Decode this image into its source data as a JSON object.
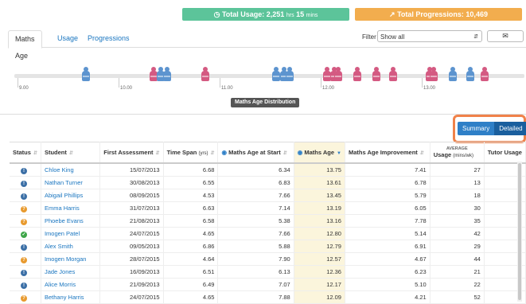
{
  "stats": {
    "usage_label": "Total Usage: 2,251",
    "usage_hrs_unit": "hrs",
    "usage_mins": "15",
    "usage_mins_unit": "mins",
    "progressions_label": "Total Progressions: 10,469",
    "usage_icon": "clock-icon",
    "progressions_icon": "chart-icon",
    "usage_color": "#5cc49a",
    "progressions_color": "#f2ad4e"
  },
  "tabs": [
    {
      "label": "Maths Age",
      "active": true
    },
    {
      "label": "Usage",
      "active": false
    },
    {
      "label": "Progressions",
      "active": false
    }
  ],
  "filter": {
    "label": "Filter",
    "value": "Show all"
  },
  "email_icon": "envelope-icon",
  "distribution": {
    "title": "Maths Age Distribution",
    "ticks": [
      "9.00",
      "10.00",
      "11.00",
      "12.00",
      "13.00"
    ],
    "pins": [
      {
        "value": 9.68,
        "color": "blue"
      },
      {
        "value": 10.35,
        "color": "pink"
      },
      {
        "value": 10.42,
        "color": "blue"
      },
      {
        "value": 10.48,
        "color": "blue"
      },
      {
        "value": 10.86,
        "color": "pink"
      },
      {
        "value": 11.56,
        "color": "blue"
      },
      {
        "value": 11.64,
        "color": "blue"
      },
      {
        "value": 11.69,
        "color": "blue"
      },
      {
        "value": 12.06,
        "color": "pink"
      },
      {
        "value": 12.13,
        "color": "pink"
      },
      {
        "value": 12.17,
        "color": "pink"
      },
      {
        "value": 12.36,
        "color": "pink"
      },
      {
        "value": 12.55,
        "color": "pink"
      },
      {
        "value": 12.72,
        "color": "pink"
      },
      {
        "value": 13.08,
        "color": "pink"
      },
      {
        "value": 13.12,
        "color": "pink"
      },
      {
        "value": 13.31,
        "color": "blue"
      },
      {
        "value": 13.48,
        "color": "blue"
      },
      {
        "value": 13.62,
        "color": "pink"
      }
    ]
  },
  "view_toggle": {
    "summary": "Summary",
    "detailed": "Detailed"
  },
  "table": {
    "headers": {
      "status": "Status",
      "student": "Student",
      "first_assessment": "First Assessment",
      "time_span": "Time Span",
      "time_span_unit": "(yrs)",
      "age_start": "Maths Age at Start",
      "maths_age": "Maths Age",
      "improvement": "Maths Age Improvement",
      "usage_top": "AVERAGE",
      "usage": "Usage",
      "usage_unit": "(mins/wk)",
      "tutor": "Tutor Usage"
    },
    "rows": [
      {
        "status": "info",
        "student": "Chloe King",
        "first": "15/07/2013",
        "span": "6.68",
        "start": "6.34",
        "age": "13.75",
        "improvement": "7.41",
        "usage": "27"
      },
      {
        "status": "info",
        "student": "Nathan Turner",
        "first": "30/08/2013",
        "span": "6.55",
        "start": "6.83",
        "age": "13.61",
        "improvement": "6.78",
        "usage": "13"
      },
      {
        "status": "info",
        "student": "Abigail Phillips",
        "first": "08/09/2015",
        "span": "4.53",
        "start": "7.66",
        "age": "13.45",
        "improvement": "5.79",
        "usage": "18"
      },
      {
        "status": "warn",
        "student": "Emma Harris",
        "first": "31/07/2013",
        "span": "6.63",
        "start": "7.14",
        "age": "13.19",
        "improvement": "6.05",
        "usage": "30"
      },
      {
        "status": "warn",
        "student": "Phoebe Evans",
        "first": "21/08/2013",
        "span": "6.58",
        "start": "5.38",
        "age": "13.16",
        "improvement": "7.78",
        "usage": "35"
      },
      {
        "status": "ok",
        "student": "Imogen Patel",
        "first": "24/07/2015",
        "span": "4.65",
        "start": "7.66",
        "age": "12.80",
        "improvement": "5.14",
        "usage": "42"
      },
      {
        "status": "info",
        "student": "Alex Smith",
        "first": "09/05/2013",
        "span": "6.86",
        "start": "5.88",
        "age": "12.79",
        "improvement": "6.91",
        "usage": "29"
      },
      {
        "status": "warn",
        "student": "Imogen Morgan",
        "first": "28/07/2015",
        "span": "4.64",
        "start": "7.90",
        "age": "12.57",
        "improvement": "4.67",
        "usage": "44"
      },
      {
        "status": "info",
        "student": "Jade Jones",
        "first": "16/09/2013",
        "span": "6.51",
        "start": "6.13",
        "age": "12.36",
        "improvement": "6.23",
        "usage": "21"
      },
      {
        "status": "info",
        "student": "Alice Morris",
        "first": "21/09/2013",
        "span": "6.49",
        "start": "7.07",
        "age": "12.17",
        "improvement": "5.10",
        "usage": "22"
      },
      {
        "status": "warn",
        "student": "Bethany Harris",
        "first": "24/07/2015",
        "span": "4.65",
        "start": "7.88",
        "age": "12.09",
        "improvement": "4.21",
        "usage": "52"
      }
    ]
  }
}
